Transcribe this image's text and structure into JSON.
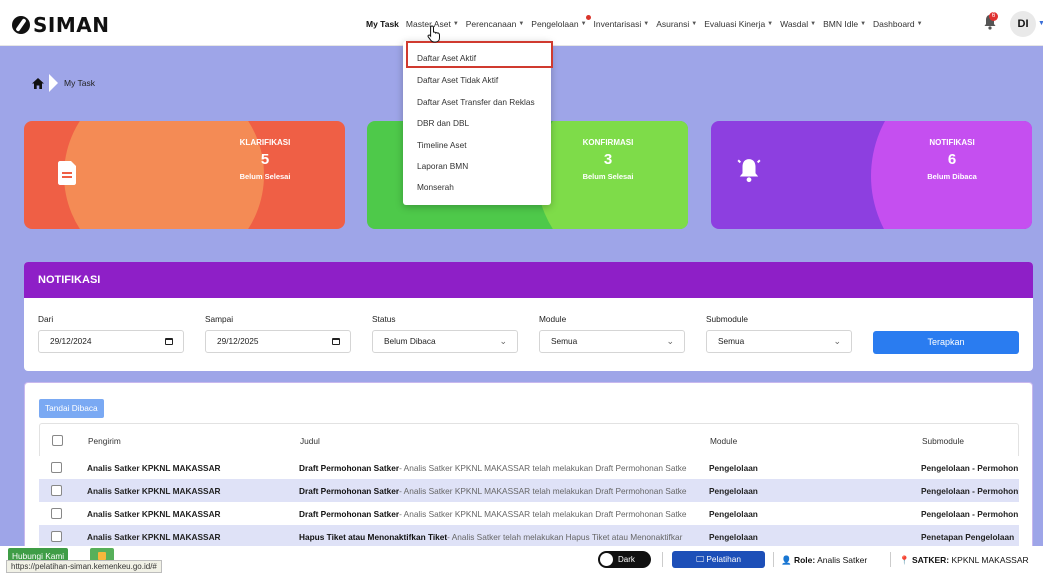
{
  "app": {
    "name": "SIMAN"
  },
  "nav": {
    "items": [
      {
        "label": "My Task"
      },
      {
        "label": "Master Aset"
      },
      {
        "label": "Perencanaan"
      },
      {
        "label": "Pengelolaan"
      },
      {
        "label": "Inventarisasi"
      },
      {
        "label": "Asuransi"
      },
      {
        "label": "Evaluasi Kinerja"
      },
      {
        "label": "Wasdal"
      },
      {
        "label": "BMN Idle"
      },
      {
        "label": "Dashboard"
      }
    ],
    "bell_badge": "6",
    "avatar": "DI"
  },
  "dropdown": {
    "items": [
      {
        "label": "Daftar Aset Aktif"
      },
      {
        "label": "Daftar Aset Tidak Aktif"
      },
      {
        "label": "Daftar Aset Transfer dan Reklas"
      },
      {
        "label": "DBR dan DBL"
      },
      {
        "label": "Timeline Aset"
      },
      {
        "label": "Laporan BMN"
      },
      {
        "label": "Monserah"
      }
    ]
  },
  "breadcrumb": {
    "current": "My Task"
  },
  "cards": [
    {
      "title": "KLARIFIKASI",
      "value": "5",
      "sub": "Belum Selesai",
      "icon": "document-icon"
    },
    {
      "title": "KONFIRMASI",
      "value": "3",
      "sub": "Belum Selesai",
      "icon": "gear-icon"
    },
    {
      "title": "NOTIFIKASI",
      "value": "6",
      "sub": "Belum Dibaca",
      "icon": "bell-icon"
    }
  ],
  "filter": {
    "title": "NOTIFIKASI",
    "dari_label": "Dari",
    "dari_value": "29/12/2024",
    "sampai_label": "Sampai",
    "sampai_value": "29/12/2025",
    "status_label": "Status",
    "status_value": "Belum Dibaca",
    "module_label": "Module",
    "module_value": "Semua",
    "submodule_label": "Submodule",
    "submodule_value": "Semua",
    "apply_label": "Terapkan"
  },
  "table": {
    "mark_button": "Tandai Dibaca",
    "headers": {
      "sender": "Pengirim",
      "title": "Judul",
      "module": "Module",
      "submodule": "Submodule"
    },
    "rows": [
      {
        "sender": "Analis Satker KPKNL MAKASSAR",
        "title_bold": "Draft Permohonan Satker",
        "title_rest": "- Analis Satker KPKNL MAKASSAR telah melakukan Draft Permohonan Satke",
        "module": "Pengelolaan",
        "submodule": "Pengelolaan - Permohon"
      },
      {
        "sender": "Analis Satker KPKNL MAKASSAR",
        "title_bold": "Draft Permohonan Satker",
        "title_rest": "- Analis Satker KPKNL MAKASSAR telah melakukan Draft Permohonan Satke",
        "module": "Pengelolaan",
        "submodule": "Pengelolaan - Permohon"
      },
      {
        "sender": "Analis Satker KPKNL MAKASSAR",
        "title_bold": "Draft Permohonan Satker",
        "title_rest": "- Analis Satker KPKNL MAKASSAR telah melakukan Draft Permohonan Satke",
        "module": "Pengelolaan",
        "submodule": "Pengelolaan - Permohon"
      },
      {
        "sender": "Analis Satker KPKNL MAKASSAR",
        "title_bold": "Hapus Tiket atau Menonaktifkan Tiket",
        "title_rest": "- Analis Satker telah melakukan Hapus Tiket atau Menonaktifkar",
        "module": "Pengelolaan",
        "submodule": "Penetapan Pengelolaan"
      }
    ]
  },
  "bottom": {
    "dark_label": "Dark",
    "pelatihan_label": "Pelatihan",
    "role_label": "Role:",
    "role_value": "Analis Satker",
    "satker_label": "SATKER:",
    "satker_value": "KPKNL MAKASSAR",
    "hubungi_label": "Hubungi Kami",
    "status_url": "https://pelatihan-siman.kemenkeu.go.id/#"
  },
  "colors": {
    "accent": "#2a7cf0",
    "panel_header": "#8e1fc7",
    "background": "#9ea5e8",
    "highlight_box": "#d03a2f"
  }
}
